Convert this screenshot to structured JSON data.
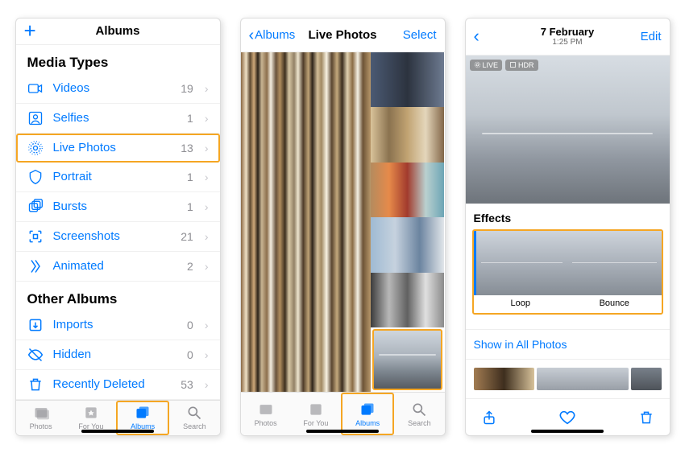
{
  "colors": {
    "accent": "#007aff",
    "highlight": "#f5a623"
  },
  "screen1": {
    "header_title": "Albums",
    "section_media": "Media Types",
    "section_other": "Other Albums",
    "media": [
      {
        "icon": "video-icon",
        "label": "Videos",
        "count": "19"
      },
      {
        "icon": "selfies-icon",
        "label": "Selfies",
        "count": "1"
      },
      {
        "icon": "live-photos-icon",
        "label": "Live Photos",
        "count": "13"
      },
      {
        "icon": "portrait-icon",
        "label": "Portrait",
        "count": "1"
      },
      {
        "icon": "bursts-icon",
        "label": "Bursts",
        "count": "1"
      },
      {
        "icon": "screenshots-icon",
        "label": "Screenshots",
        "count": "21"
      },
      {
        "icon": "animated-icon",
        "label": "Animated",
        "count": "2"
      }
    ],
    "other": [
      {
        "icon": "imports-icon",
        "label": "Imports",
        "count": "0"
      },
      {
        "icon": "hidden-icon",
        "label": "Hidden",
        "count": "0"
      },
      {
        "icon": "trash-icon",
        "label": "Recently Deleted",
        "count": "53"
      }
    ],
    "tabs": [
      "Photos",
      "For You",
      "Albums",
      "Search"
    ]
  },
  "screen2": {
    "back": "Albums",
    "title": "Live Photos",
    "select": "Select",
    "tabs": [
      "Photos",
      "For You",
      "Albums",
      "Search"
    ]
  },
  "screen3": {
    "date": "7 February",
    "time": "1:25 PM",
    "edit": "Edit",
    "badge_live": "LIVE",
    "badge_hdr": "HDR",
    "effects_title": "Effects",
    "effect_loop": "Loop",
    "effect_bounce": "Bounce",
    "show_all": "Show in All Photos"
  }
}
